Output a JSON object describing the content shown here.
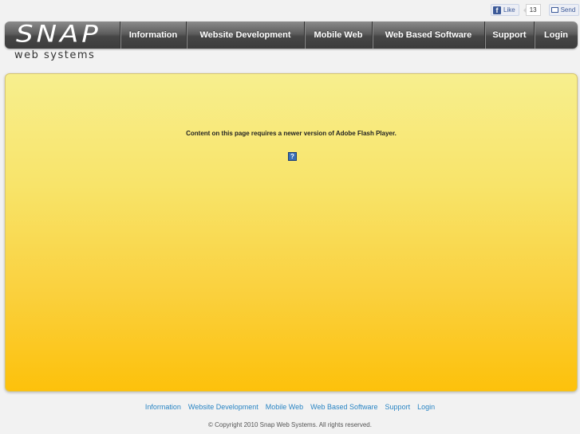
{
  "social": {
    "like_label": "Like",
    "like_count": "13",
    "send_label": "Send",
    "like_icon": "facebook-f-icon",
    "send_icon": "send-envelope-icon"
  },
  "header": {
    "logo_text": "SNAP",
    "tagline": "web systems",
    "nav": [
      {
        "label": "Information"
      },
      {
        "label": "Website Development"
      },
      {
        "label": "Mobile Web"
      },
      {
        "label": "Web Based Software"
      },
      {
        "label": "Support"
      },
      {
        "label": "Login"
      }
    ]
  },
  "main": {
    "flash_message": "Content on this page requires a newer version of Adobe Flash Player.",
    "flash_icon_glyph": "?",
    "colors": {
      "panel_top": "#f7ef8e",
      "panel_bottom": "#fdc10b"
    }
  },
  "footer": {
    "links": [
      {
        "label": "Information"
      },
      {
        "label": "Website Development"
      },
      {
        "label": "Mobile Web"
      },
      {
        "label": "Web Based Software"
      },
      {
        "label": "Support"
      },
      {
        "label": "Login"
      }
    ],
    "copyright": "© Copyright 2010 Snap Web Systems. All rights reserved.",
    "link_color": "#2a85c4"
  }
}
